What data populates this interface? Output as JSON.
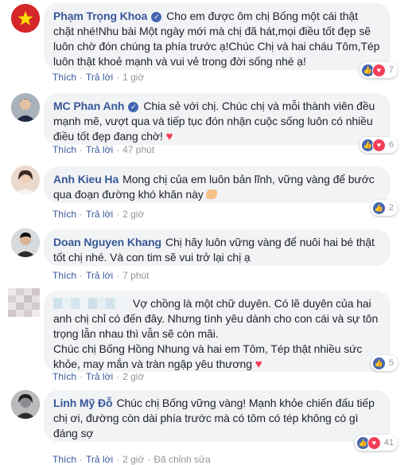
{
  "comments": [
    {
      "author": "Phạm Trọng Khoa",
      "verified": true,
      "text": "Cho em được ôm chị Bống một cái thật chặt nhé!Nhu bài Một ngày mới mà chị đã hát,mọi điều tốt đẹp sẽ luôn chờ đón chúng ta phía trước ạ!Chúc Chị và hai cháu Tôm,Tép luôn thật khoẻ mạnh và vui vẻ trong đời sống nhé ạ!",
      "like_label": "Thích",
      "reply_label": "Trả lời",
      "time": "1 giờ",
      "reactions": [
        "like",
        "love"
      ],
      "reaction_count": "7"
    },
    {
      "author": "MC Phan Anh",
      "verified": true,
      "text": "Chia sẻ với chị. Chúc chị và mỗi thành viên đều mạnh mẽ, vượt qua và tiếp tục đón nhận cuộc sống luôn có nhiều điều tốt đẹp đang chờ!",
      "like_label": "Thích",
      "reply_label": "Trả lời",
      "time": "47 phút",
      "reactions": [
        "like",
        "love"
      ],
      "reaction_count": "6"
    },
    {
      "author": "Anh Kieu Ha",
      "verified": false,
      "text": "Mong chị của em luôn bản lĩnh, vững vàng để bước qua đoạn đường khó khăn này",
      "like_label": "Thích",
      "reply_label": "Trả lời",
      "time": "2 giờ",
      "reactions": [
        "like"
      ],
      "reaction_count": "2"
    },
    {
      "author": "Doan Nguyen Khang",
      "verified": false,
      "text": "Chị hãy luôn vững vàng để nuôi hai bé thật tốt chị nhé. Và con tim sẽ vui trở lại chị ạ",
      "like_label": "Thích",
      "reply_label": "Trả lời",
      "time": "7 phút"
    },
    {
      "author": "",
      "verified": false,
      "text": "Vợ chồng là một chữ duyên. Có lẽ duyên của hai anh chị chỉ có đến đây. Nhưng tình yêu dành cho con cái và sự tôn trọng lẫn nhau thì vẫn sẽ còn mãi.",
      "text2": "Chúc chị Bống Hồng Nhung và hai em Tôm, Tép thật nhiều sức khỏe, may mắn và tràn ngập yêu thương",
      "like_label": "Thích",
      "reply_label": "Trả lời",
      "time": "2 giờ",
      "reactions": [
        "like"
      ],
      "reaction_count": "5"
    },
    {
      "author": "Linh Mỹ Đỗ",
      "verified": false,
      "text": "Chúc chị Bống vững vàng! Mạnh khỏe chiến đấu tiếp chị ơi, đường còn dài phía trước mà có tôm có tép không có gì đáng sợ",
      "like_label": "Thích",
      "reply_label": "Trả lời",
      "time": "2 giờ",
      "edited_label": "Đã chỉnh sửa",
      "reactions": [
        "like",
        "love"
      ],
      "reaction_count": "41"
    }
  ]
}
